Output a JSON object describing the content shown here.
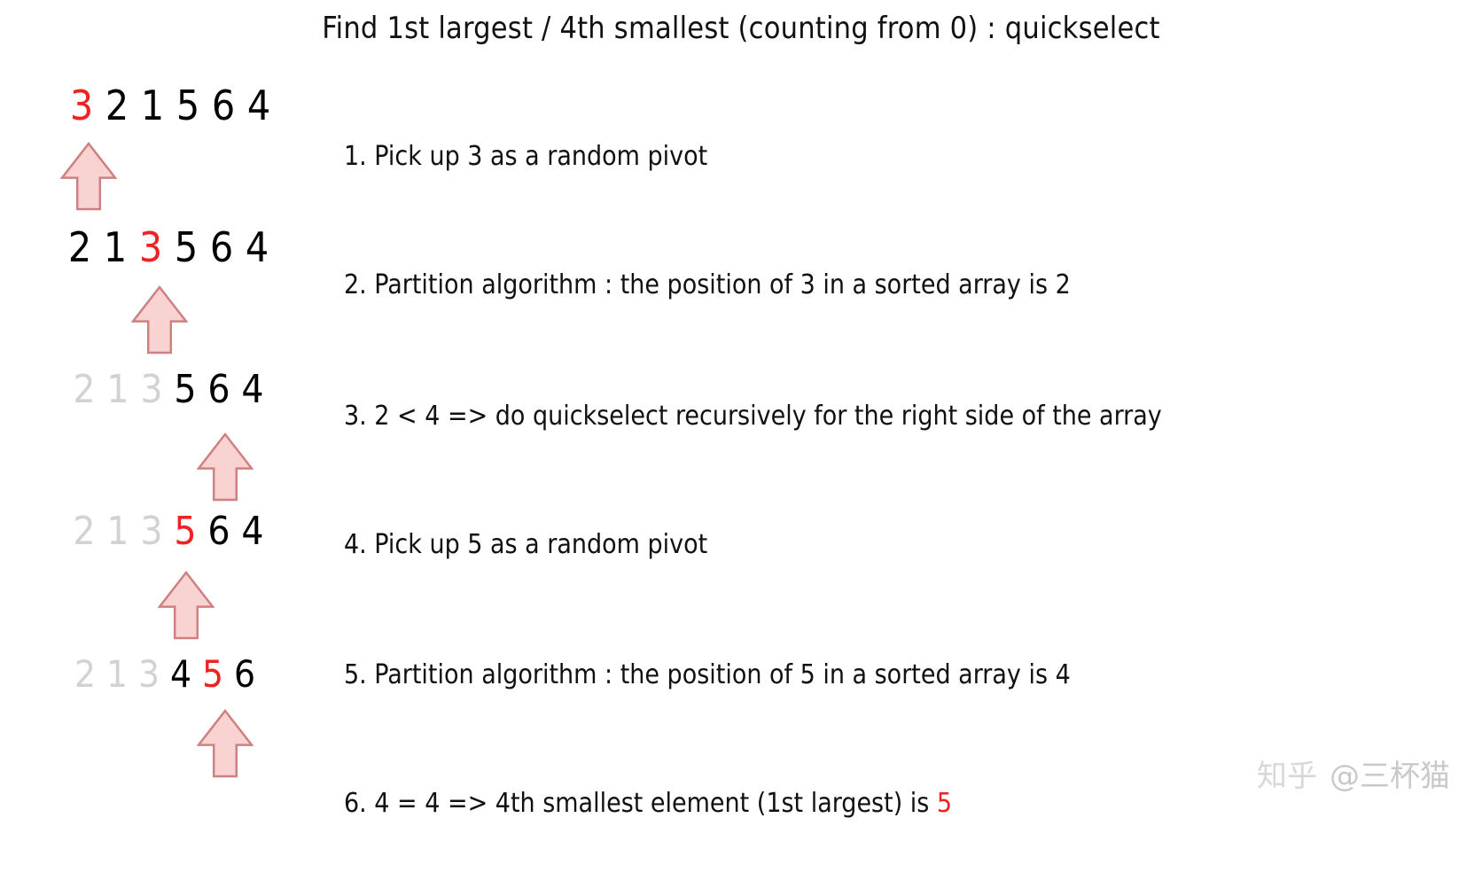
{
  "title": "Find 1st largest / 4th smallest (counting from 0) : quickselect",
  "colors": {
    "pivot_red": "#ef2222",
    "faded_gray": "#d2d2d2",
    "arrow_fill": "#f9d2d2",
    "arrow_stroke": "#cf8080",
    "text_black": "#111111",
    "watermark_gray": "#cfcfcf"
  },
  "rows": [
    {
      "name": "row-1",
      "digits": [
        {
          "value": "3",
          "style": "red"
        },
        {
          "value": "2",
          "style": "black"
        },
        {
          "value": "1",
          "style": "black"
        },
        {
          "value": "5",
          "style": "black"
        },
        {
          "value": "6",
          "style": "black"
        },
        {
          "value": "4",
          "style": "black"
        }
      ],
      "arrow_index": 0
    },
    {
      "name": "row-2",
      "digits": [
        {
          "value": "2",
          "style": "black"
        },
        {
          "value": "1",
          "style": "black"
        },
        {
          "value": "3",
          "style": "red"
        },
        {
          "value": "5",
          "style": "black"
        },
        {
          "value": "6",
          "style": "black"
        },
        {
          "value": "4",
          "style": "black"
        }
      ],
      "arrow_index": 2
    },
    {
      "name": "row-3",
      "digits": [
        {
          "value": "2",
          "style": "faded"
        },
        {
          "value": "1",
          "style": "faded"
        },
        {
          "value": "3",
          "style": "faded"
        },
        {
          "value": "5",
          "style": "black"
        },
        {
          "value": "6",
          "style": "black"
        },
        {
          "value": "4",
          "style": "black"
        }
      ],
      "arrow_index": 3
    },
    {
      "name": "row-4",
      "digits": [
        {
          "value": "2",
          "style": "faded"
        },
        {
          "value": "1",
          "style": "faded"
        },
        {
          "value": "3",
          "style": "faded"
        },
        {
          "value": "5",
          "style": "red"
        },
        {
          "value": "6",
          "style": "black"
        },
        {
          "value": "4",
          "style": "black"
        }
      ],
      "arrow_index": 3
    },
    {
      "name": "row-5",
      "digits": [
        {
          "value": "2",
          "style": "faded"
        },
        {
          "value": "1",
          "style": "faded"
        },
        {
          "value": "3",
          "style": "faded"
        },
        {
          "value": "4",
          "style": "black"
        },
        {
          "value": "5",
          "style": "red"
        },
        {
          "value": "6",
          "style": "black"
        }
      ],
      "arrow_index": 4
    }
  ],
  "steps": [
    {
      "name": "step-1",
      "text": "1. Pick up 3 as a random pivot"
    },
    {
      "name": "step-2",
      "text": "2. Partition algorithm : the position of 3 in a sorted array is 2"
    },
    {
      "name": "step-3",
      "text": "3. 2 < 4 => do quickselect recursively for the right side of the array"
    },
    {
      "name": "step-4",
      "text": "4. Pick up 5 as a random pivot"
    },
    {
      "name": "step-5",
      "text": "5. Partition algorithm : the position of 5 in a sorted array is 4"
    },
    {
      "name": "step-6",
      "text": "6. 4 = 4 => 4th smallest element (1st largest) is ",
      "highlight": "5"
    }
  ],
  "watermark": {
    "logo": "知乎",
    "handle": "@三杯猫"
  }
}
